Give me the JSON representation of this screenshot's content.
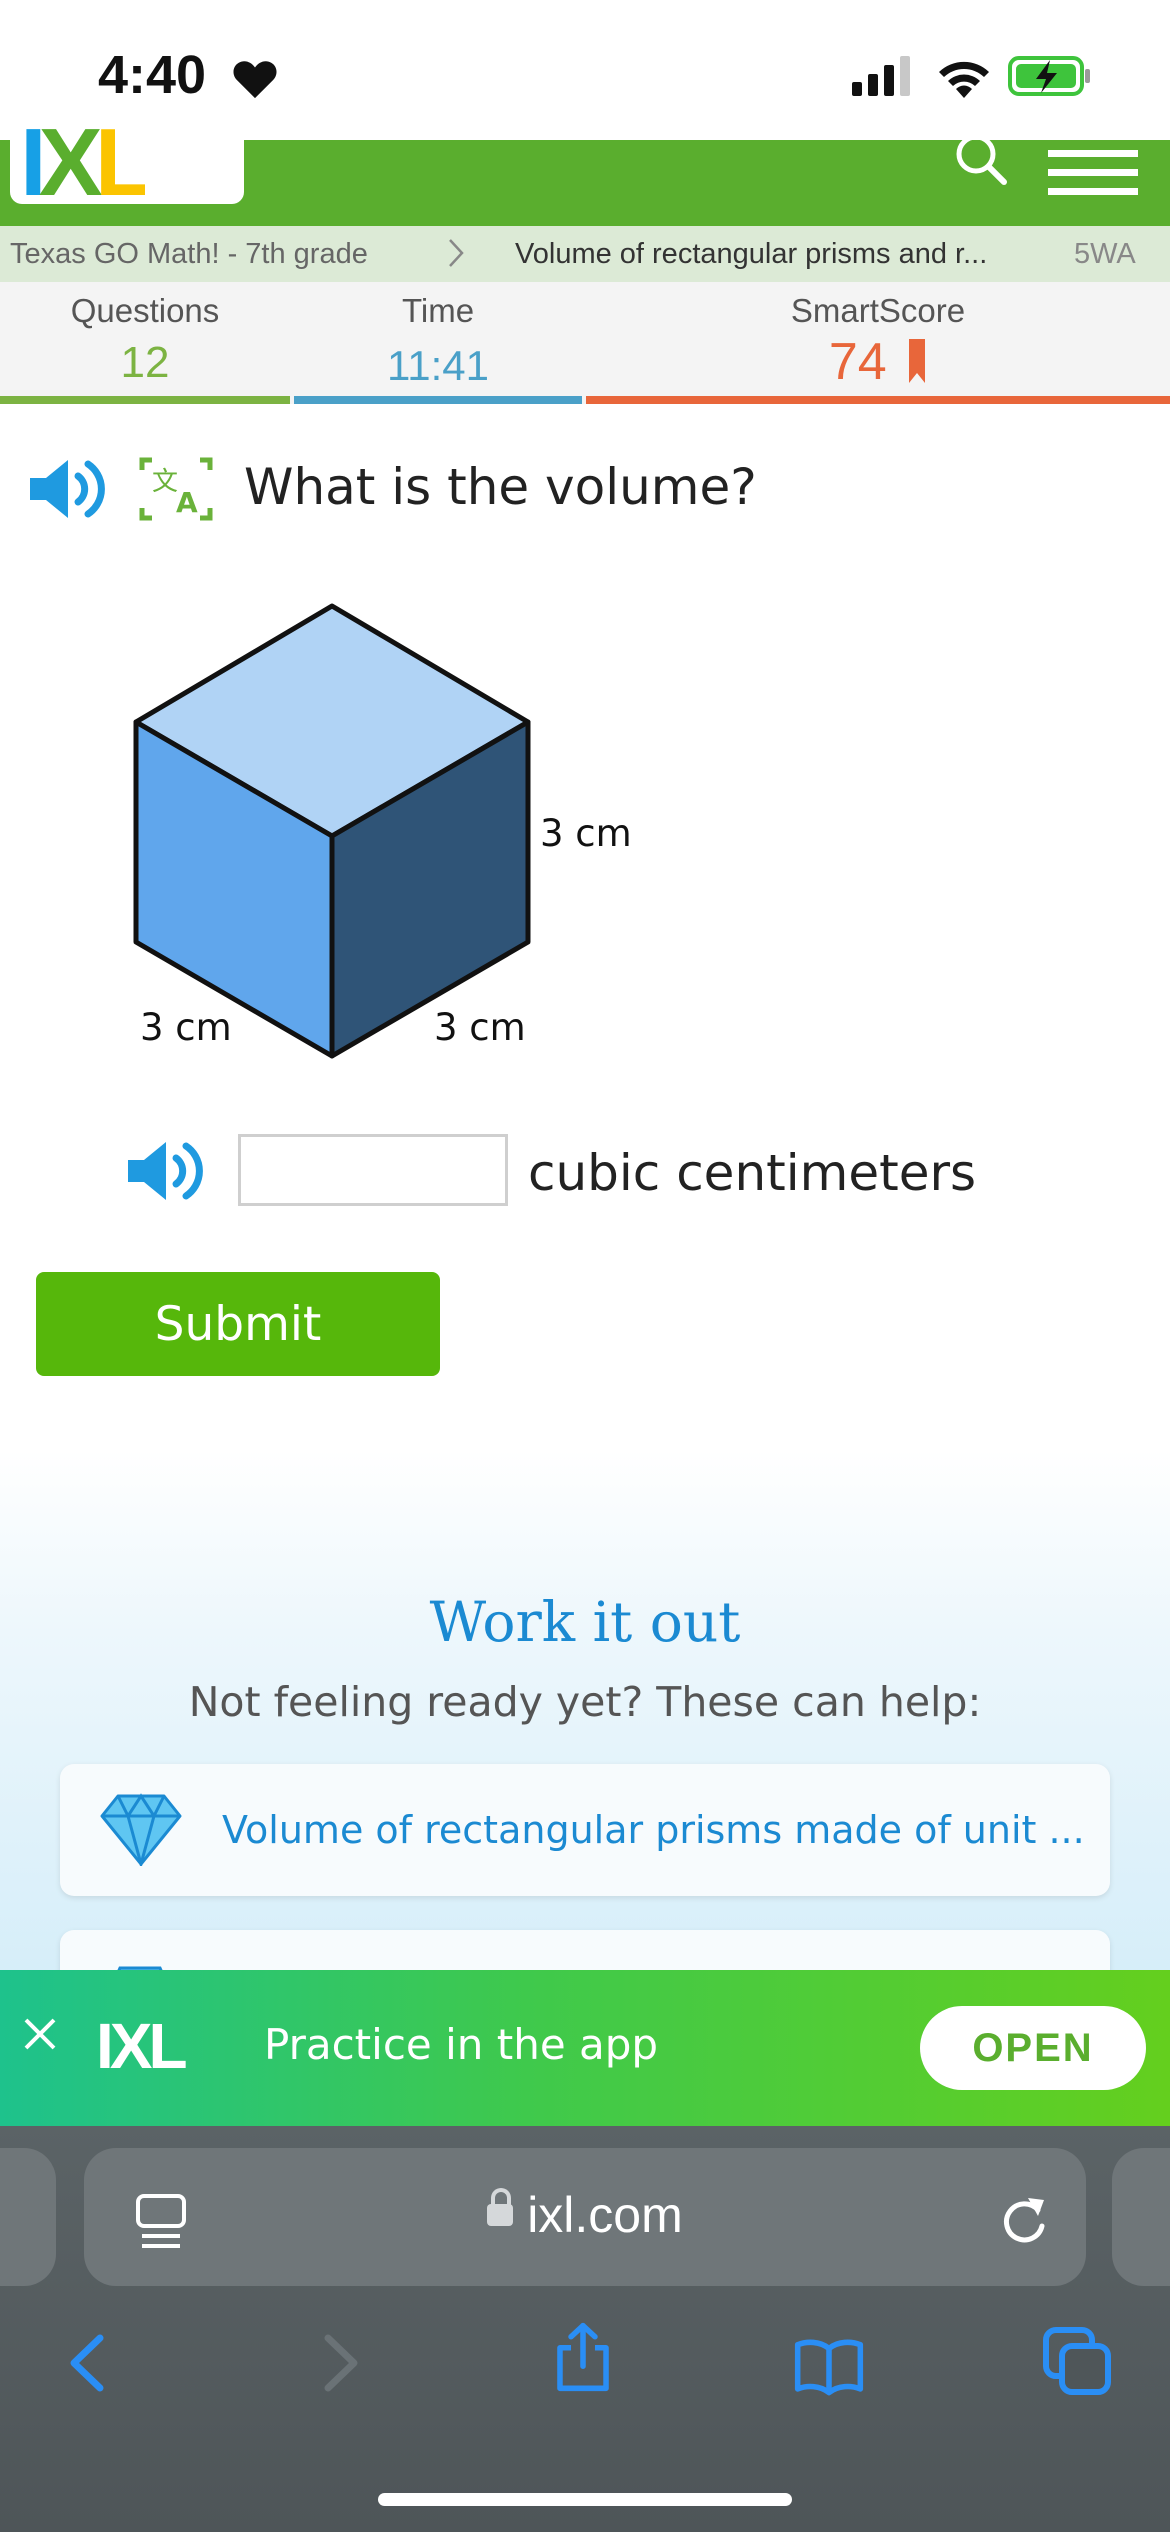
{
  "status": {
    "time": "4:40"
  },
  "header": {
    "logo": {
      "i": "I",
      "x": "X",
      "l": "L"
    },
    "icons": [
      "search-icon",
      "menu-icon"
    ]
  },
  "breadcrumb": {
    "course": "Texas GO Math! - 7th grade",
    "skill": "Volume of rectangular prisms and r...",
    "code": "5WA"
  },
  "stats": {
    "questions_label": "Questions",
    "questions_value": "12",
    "time_label": "Time",
    "time_value": "11:41",
    "score_label": "SmartScore",
    "score_value": "74"
  },
  "question": {
    "prompt": "What is the volume?",
    "figure": {
      "height_label": "3 cm",
      "left_label": "3 cm",
      "right_label": "3 cm"
    },
    "answer_value": "",
    "unit": "cubic centimeters",
    "submit_label": "Submit"
  },
  "work_it_out": {
    "title": "Work it out",
    "subtitle": "Not feeling ready yet? These can help:",
    "resources": [
      {
        "label": "Volume of rectangular prisms made of unit ...",
        "icon": "diamond-icon"
      }
    ]
  },
  "app_banner": {
    "logo": "IXL",
    "text": "Practice in the app",
    "open_label": "OPEN"
  },
  "browser": {
    "url": "ixl.com"
  },
  "colors": {
    "ixl_green": "#5aae2e",
    "questions_green": "#7cb342",
    "time_blue": "#4aa0c8",
    "score_orange": "#e8663a",
    "submit_green": "#56b70b",
    "link_blue": "#1b8ad2"
  }
}
